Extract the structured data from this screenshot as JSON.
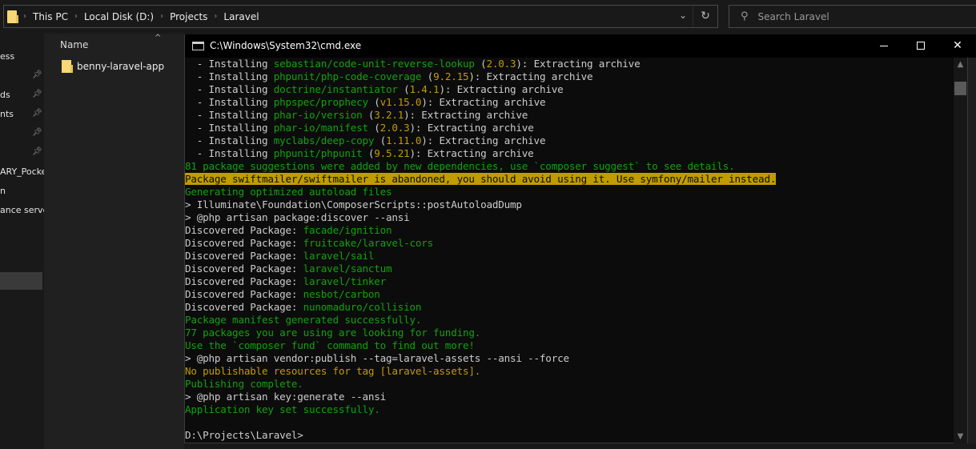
{
  "explorer": {
    "breadcrumb": [
      "This PC",
      "Local Disk (D:)",
      "Projects",
      "Laravel"
    ],
    "search_placeholder": "Search Laravel",
    "nav_items": [
      {
        "label": "ess",
        "pinned": false
      },
      {
        "label": "",
        "pinned": true
      },
      {
        "label": "ds",
        "pinned": true
      },
      {
        "label": "nts",
        "pinned": true
      },
      {
        "label": "",
        "pinned": true
      },
      {
        "label": "",
        "pinned": true
      },
      {
        "label": "ARY_Pocke",
        "pinned": false
      },
      {
        "label": "n",
        "pinned": false
      },
      {
        "label": "ance server",
        "pinned": false
      }
    ],
    "column_header": "Name",
    "files": [
      {
        "name": "benny-laravel-app",
        "type": "folder"
      }
    ]
  },
  "cmd": {
    "title": "C:\\Windows\\System32\\cmd.exe",
    "lines": [
      [
        {
          "t": "  - Installing ",
          "c": ""
        },
        {
          "t": "sebastian/code-unit-reverse-lookup",
          "c": "gd"
        },
        {
          "t": " (",
          "c": ""
        },
        {
          "t": "2.0.3",
          "c": "y"
        },
        {
          "t": "): Extracting archive",
          "c": ""
        }
      ],
      [
        {
          "t": "  - Installing ",
          "c": ""
        },
        {
          "t": "phpunit/php-code-coverage",
          "c": "gd"
        },
        {
          "t": " (",
          "c": ""
        },
        {
          "t": "9.2.15",
          "c": "y"
        },
        {
          "t": "): Extracting archive",
          "c": ""
        }
      ],
      [
        {
          "t": "  - Installing ",
          "c": ""
        },
        {
          "t": "doctrine/instantiator",
          "c": "gd"
        },
        {
          "t": " (",
          "c": ""
        },
        {
          "t": "1.4.1",
          "c": "y"
        },
        {
          "t": "): Extracting archive",
          "c": ""
        }
      ],
      [
        {
          "t": "  - Installing ",
          "c": ""
        },
        {
          "t": "phpspec/prophecy",
          "c": "gd"
        },
        {
          "t": " (",
          "c": ""
        },
        {
          "t": "v1.15.0",
          "c": "y"
        },
        {
          "t": "): Extracting archive",
          "c": ""
        }
      ],
      [
        {
          "t": "  - Installing ",
          "c": ""
        },
        {
          "t": "phar-io/version",
          "c": "gd"
        },
        {
          "t": " (",
          "c": ""
        },
        {
          "t": "3.2.1",
          "c": "y"
        },
        {
          "t": "): Extracting archive",
          "c": ""
        }
      ],
      [
        {
          "t": "  - Installing ",
          "c": ""
        },
        {
          "t": "phar-io/manifest",
          "c": "gd"
        },
        {
          "t": " (",
          "c": ""
        },
        {
          "t": "2.0.3",
          "c": "y"
        },
        {
          "t": "): Extracting archive",
          "c": ""
        }
      ],
      [
        {
          "t": "  - Installing ",
          "c": ""
        },
        {
          "t": "myclabs/deep-copy",
          "c": "gd"
        },
        {
          "t": " (",
          "c": ""
        },
        {
          "t": "1.11.0",
          "c": "y"
        },
        {
          "t": "): Extracting archive",
          "c": ""
        }
      ],
      [
        {
          "t": "  - Installing ",
          "c": ""
        },
        {
          "t": "phpunit/phpunit",
          "c": "gd"
        },
        {
          "t": " (",
          "c": ""
        },
        {
          "t": "9.5.21",
          "c": "y"
        },
        {
          "t": "): Extracting archive",
          "c": ""
        }
      ],
      [
        {
          "t": "81 package suggestions were added by new dependencies, use `composer suggest` to see details.",
          "c": "gd"
        }
      ],
      [
        {
          "t": "Package swiftmailer/swiftmailer is abandoned, you should avoid using it. Use symfony/mailer instead.",
          "c": "hl"
        }
      ],
      [
        {
          "t": "Generating optimized autoload files",
          "c": "gd"
        }
      ],
      [
        {
          "t": "> Illuminate\\Foundation\\ComposerScripts::postAutoloadDump",
          "c": ""
        }
      ],
      [
        {
          "t": "> @php artisan package:discover --ansi",
          "c": ""
        }
      ],
      [
        {
          "t": "Discovered Package: ",
          "c": ""
        },
        {
          "t": "facade/ignition",
          "c": "gd"
        }
      ],
      [
        {
          "t": "Discovered Package: ",
          "c": ""
        },
        {
          "t": "fruitcake/laravel-cors",
          "c": "gd"
        }
      ],
      [
        {
          "t": "Discovered Package: ",
          "c": ""
        },
        {
          "t": "laravel/sail",
          "c": "gd"
        }
      ],
      [
        {
          "t": "Discovered Package: ",
          "c": ""
        },
        {
          "t": "laravel/sanctum",
          "c": "gd"
        }
      ],
      [
        {
          "t": "Discovered Package: ",
          "c": ""
        },
        {
          "t": "laravel/tinker",
          "c": "gd"
        }
      ],
      [
        {
          "t": "Discovered Package: ",
          "c": ""
        },
        {
          "t": "nesbot/carbon",
          "c": "gd"
        }
      ],
      [
        {
          "t": "Discovered Package: ",
          "c": ""
        },
        {
          "t": "nunomaduro/collision",
          "c": "gd"
        }
      ],
      [
        {
          "t": "Package manifest generated successfully.",
          "c": "gd"
        }
      ],
      [
        {
          "t": "77 packages you are using are looking for funding.",
          "c": "gd"
        }
      ],
      [
        {
          "t": "Use the `composer fund` command to find out more!",
          "c": "gd"
        }
      ],
      [
        {
          "t": "> @php artisan vendor:publish --tag=laravel-assets --ansi --force",
          "c": ""
        }
      ],
      [
        {
          "t": "No publishable resources for tag [laravel-assets].",
          "c": "y"
        }
      ],
      [
        {
          "t": "Publishing complete.",
          "c": "gd"
        }
      ],
      [
        {
          "t": "> @php artisan key:generate --ansi",
          "c": ""
        }
      ],
      [
        {
          "t": "Application key set successfully.",
          "c": "gd"
        }
      ],
      [
        {
          "t": "",
          "c": ""
        }
      ],
      [
        {
          "t": "D:\\Projects\\Laravel>",
          "c": ""
        }
      ]
    ]
  },
  "colors": {
    "console_bg": "#0c0c0c",
    "console_fg": "#cccccc",
    "green": "#13a10e",
    "yellow": "#c19c00",
    "folder": "#f8d775"
  }
}
